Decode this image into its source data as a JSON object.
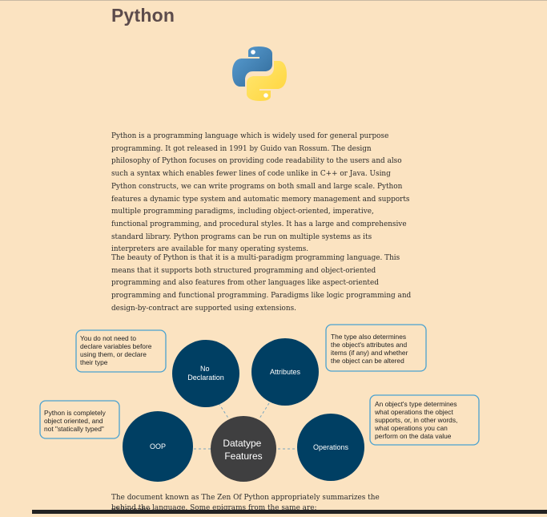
{
  "page": {
    "title": "Python"
  },
  "logo": {
    "label": "python-logo"
  },
  "paragraphs": {
    "p1": "Python is a programming language which is widely used for general purpose programming. It got released in 1991 by Guido van Rossum. The design philosophy of Python focuses on providing code readability to the users and also such a syntax which enables fewer lines of code unlike in C++ or Java. Using Python constructs, we can write programs on both small and large scale. Python features a dynamic type system and automatic memory management and supports multiple programming paradigms, including object-oriented, imperative, functional programming, and procedural styles. It has a large and comprehensive standard library. Python programs can be run on multiple systems as its interpreters are available for many operating systems.",
    "p2": "The beauty of Python is that it is a multi-paradigm programming language. This means that it supports both structured programming and object-oriented programming and also features from other languages like aspect-oriented programming and functional programming. Paradigms like logic programming and design-by-contract are supported using extensions.",
    "p3": "The document known as The Zen Of Python appropriately summarizes the philosophy",
    "p4": "behind the language. Some epigrams from the same are:"
  },
  "diagram": {
    "center": [
      "Datatype",
      "Features"
    ],
    "nodes": {
      "no_declaration": [
        "No",
        "Declaration"
      ],
      "attributes": "Attributes",
      "oop": "OOP",
      "operations": "Operations"
    },
    "callouts": {
      "no_declaration": [
        "You do not need to",
        "declare variables before",
        "using them, or declare",
        "their type"
      ],
      "attributes": [
        "The type also determines",
        "the object's attributes and",
        "items (if any) and whether",
        "the object can be altered"
      ],
      "oop": [
        "Python is completely",
        "object oriented, and",
        "not \"statically typed\""
      ],
      "operations": [
        "An object's type determines",
        "what operations the object",
        "supports, or, in other words,",
        "what operations you can",
        "perform on the data value"
      ]
    },
    "colors": {
      "node": "#003f63",
      "center": "#3f3f40",
      "callout_border": "#4aa2d0",
      "connector": "#7aa6c0"
    }
  }
}
